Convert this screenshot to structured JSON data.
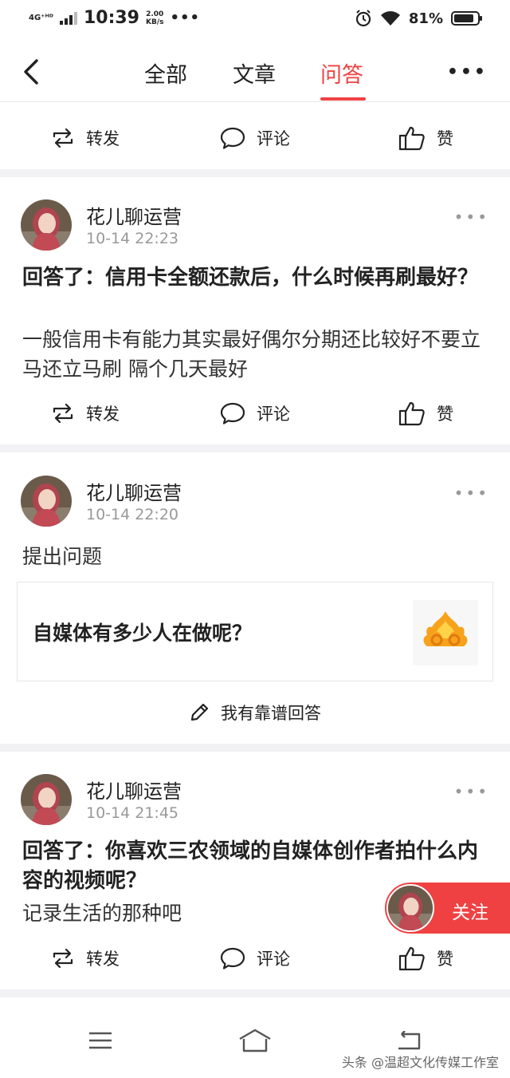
{
  "status_bar": {
    "network": "4G⁺ᴴᴰ",
    "time": "10:39",
    "speed_value": "2.00",
    "speed_unit": "KB/s",
    "dots": "•••",
    "battery": "81%"
  },
  "nav": {
    "tabs": [
      {
        "label": "全部"
      },
      {
        "label": "文章"
      },
      {
        "label": "问答"
      }
    ],
    "active_tab": "问答",
    "more": "•••",
    "accent_color": "#f04142"
  },
  "actions": {
    "repost": "转发",
    "comment": "评论",
    "like": "赞"
  },
  "posts": [
    {
      "author": "花儿聊运营",
      "time": "10-14 22:23",
      "title": "回答了：信用卡全额还款后，什么时候再刷最好？",
      "body": "一般信用卡有能力其实最好偶尔分期还比较好不要立马还立马刷 隔个几天最好"
    },
    {
      "author": "花儿聊运营",
      "time": "10-14 22:20",
      "kind": "提出问题",
      "question": "自媒体有多少人在做呢？",
      "answer_button": "我有靠谱回答"
    },
    {
      "author": "花儿聊运营",
      "time": "10-14 21:45",
      "title": "回答了：你喜欢三农领域的自媒体创作者拍什么内容的视频呢？",
      "body": "记录生活的那种吧"
    }
  ],
  "follow": {
    "label": "关注"
  },
  "watermark": "头条 @温超文化传媒工作室"
}
